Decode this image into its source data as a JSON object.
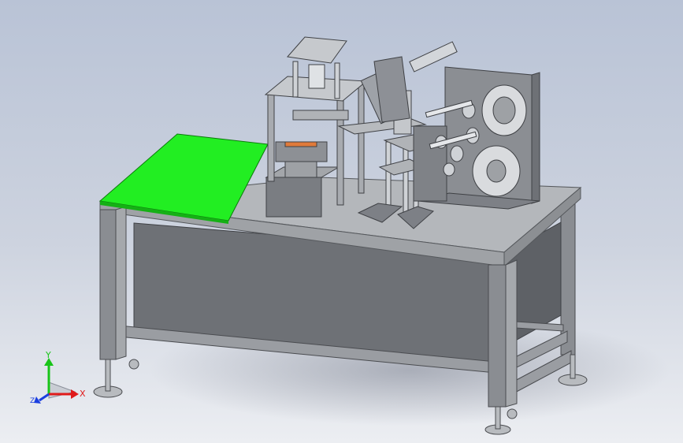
{
  "viewport": {
    "background_top": "#b9c3d6",
    "background_bottom": "#eceef2"
  },
  "model": {
    "frame_color": "#8a8d92",
    "table_top_color": "#b4b7bb",
    "panel_color": "#6e7176",
    "green_plate_color": "#22ee22",
    "part_color": "#9aa0a8"
  },
  "triad": {
    "x_label": "X",
    "y_label": "Y",
    "z_label": "Z",
    "x_color": "#e01b1b",
    "y_color": "#18c418",
    "z_color": "#1b3fe0"
  }
}
